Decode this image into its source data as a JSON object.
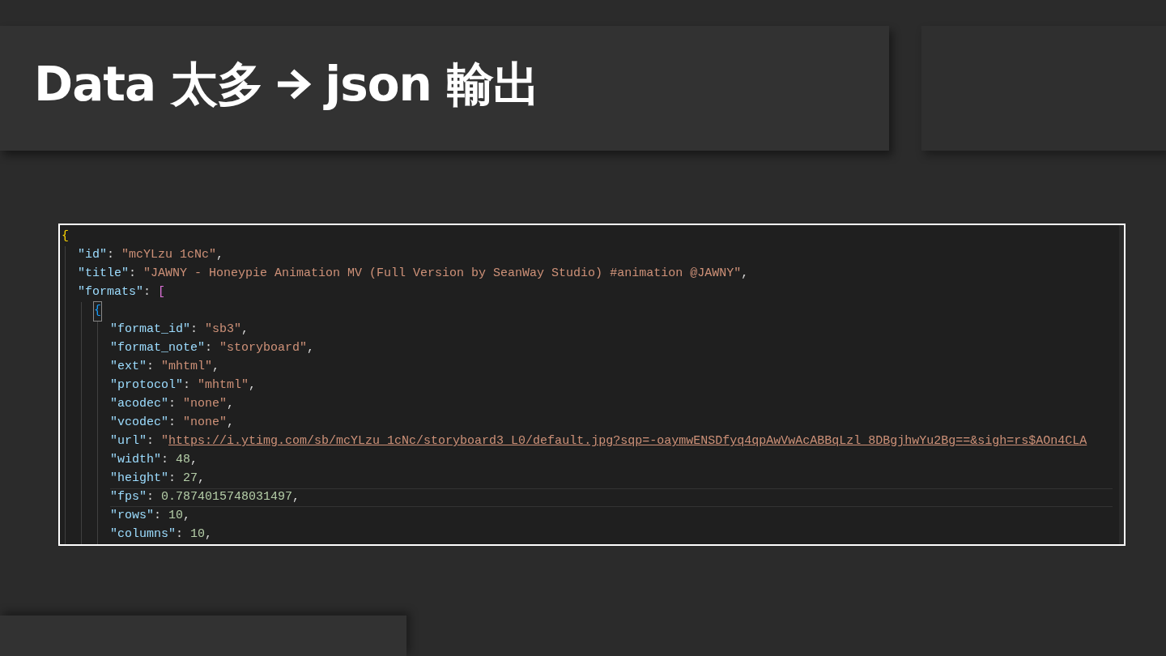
{
  "slide": {
    "title_left": "Data 太多",
    "title_right": "json 輸出"
  },
  "code": {
    "lines": [
      {
        "current": false,
        "tokens": [
          {
            "kind": "brace",
            "text": "{"
          }
        ],
        "children": [
          {
            "current": false,
            "tokens": [
              {
                "kind": "key",
                "text": "\"id\""
              },
              {
                "kind": "punct",
                "text": ": "
              },
              {
                "kind": "string",
                "text": "\"mcYLzu 1cNc\""
              },
              {
                "kind": "punct",
                "text": ","
              }
            ]
          },
          {
            "current": false,
            "tokens": [
              {
                "kind": "key",
                "text": "\"title\""
              },
              {
                "kind": "punct",
                "text": ": "
              },
              {
                "kind": "string",
                "text": "\"JAWNY - Honeypie Animation MV (Full Version by SeanWay Studio) #animation @JAWNY\""
              },
              {
                "kind": "punct",
                "text": ","
              }
            ]
          },
          {
            "current": false,
            "tokens": [
              {
                "kind": "key",
                "text": "\"formats\""
              },
              {
                "kind": "punct",
                "text": ": "
              },
              {
                "kind": "bracket",
                "text": "["
              }
            ],
            "children": [
              {
                "current": false,
                "tokens": [
                  {
                    "kind": "inner_brace",
                    "text": "{"
                  }
                ],
                "children": [
                  {
                    "current": false,
                    "tokens": [
                      {
                        "kind": "key",
                        "text": "\"format_id\""
                      },
                      {
                        "kind": "punct",
                        "text": ": "
                      },
                      {
                        "kind": "string",
                        "text": "\"sb3\""
                      },
                      {
                        "kind": "punct",
                        "text": ","
                      }
                    ]
                  },
                  {
                    "current": false,
                    "tokens": [
                      {
                        "kind": "key",
                        "text": "\"format_note\""
                      },
                      {
                        "kind": "punct",
                        "text": ": "
                      },
                      {
                        "kind": "string",
                        "text": "\"storyboard\""
                      },
                      {
                        "kind": "punct",
                        "text": ","
                      }
                    ]
                  },
                  {
                    "current": false,
                    "tokens": [
                      {
                        "kind": "key",
                        "text": "\"ext\""
                      },
                      {
                        "kind": "punct",
                        "text": ": "
                      },
                      {
                        "kind": "string",
                        "text": "\"mhtml\""
                      },
                      {
                        "kind": "punct",
                        "text": ","
                      }
                    ]
                  },
                  {
                    "current": false,
                    "tokens": [
                      {
                        "kind": "key",
                        "text": "\"protocol\""
                      },
                      {
                        "kind": "punct",
                        "text": ": "
                      },
                      {
                        "kind": "string",
                        "text": "\"mhtml\""
                      },
                      {
                        "kind": "punct",
                        "text": ","
                      }
                    ]
                  },
                  {
                    "current": false,
                    "tokens": [
                      {
                        "kind": "key",
                        "text": "\"acodec\""
                      },
                      {
                        "kind": "punct",
                        "text": ": "
                      },
                      {
                        "kind": "string",
                        "text": "\"none\""
                      },
                      {
                        "kind": "punct",
                        "text": ","
                      }
                    ]
                  },
                  {
                    "current": false,
                    "tokens": [
                      {
                        "kind": "key",
                        "text": "\"vcodec\""
                      },
                      {
                        "kind": "punct",
                        "text": ": "
                      },
                      {
                        "kind": "string",
                        "text": "\"none\""
                      },
                      {
                        "kind": "punct",
                        "text": ","
                      }
                    ]
                  },
                  {
                    "current": false,
                    "tokens": [
                      {
                        "kind": "key",
                        "text": "\"url\""
                      },
                      {
                        "kind": "punct",
                        "text": ": "
                      },
                      {
                        "kind": "string",
                        "text": "\""
                      },
                      {
                        "kind": "link",
                        "text": "https://i.ytimg.com/sb/mcYLzu_1cNc/storyboard3_L0/default.jpg?sqp=-oaymwENSDfyq4qpAwVwAcABBqLzl_8DBgjhwYu2Bg==&sigh=rs$AOn4CLA"
                      }
                    ]
                  },
                  {
                    "current": false,
                    "tokens": [
                      {
                        "kind": "key",
                        "text": "\"width\""
                      },
                      {
                        "kind": "punct",
                        "text": ": "
                      },
                      {
                        "kind": "number",
                        "text": "48"
                      },
                      {
                        "kind": "punct",
                        "text": ","
                      }
                    ]
                  },
                  {
                    "current": false,
                    "tokens": [
                      {
                        "kind": "key",
                        "text": "\"height\""
                      },
                      {
                        "kind": "punct",
                        "text": ": "
                      },
                      {
                        "kind": "number",
                        "text": "27"
                      },
                      {
                        "kind": "punct",
                        "text": ","
                      }
                    ]
                  },
                  {
                    "current": true,
                    "tokens": [
                      {
                        "kind": "key",
                        "text": "\"fps\""
                      },
                      {
                        "kind": "punct",
                        "text": ": "
                      },
                      {
                        "kind": "number",
                        "text": "0.7874015748031497"
                      },
                      {
                        "kind": "punct",
                        "text": ","
                      }
                    ]
                  },
                  {
                    "current": false,
                    "tokens": [
                      {
                        "kind": "key",
                        "text": "\"rows\""
                      },
                      {
                        "kind": "punct",
                        "text": ": "
                      },
                      {
                        "kind": "number",
                        "text": "10"
                      },
                      {
                        "kind": "punct",
                        "text": ","
                      }
                    ]
                  },
                  {
                    "current": false,
                    "tokens": [
                      {
                        "kind": "key",
                        "text": "\"columns\""
                      },
                      {
                        "kind": "punct",
                        "text": ": "
                      },
                      {
                        "kind": "number",
                        "text": "10"
                      },
                      {
                        "kind": "punct",
                        "text": ","
                      }
                    ]
                  }
                ]
              }
            ]
          }
        ]
      }
    ]
  }
}
